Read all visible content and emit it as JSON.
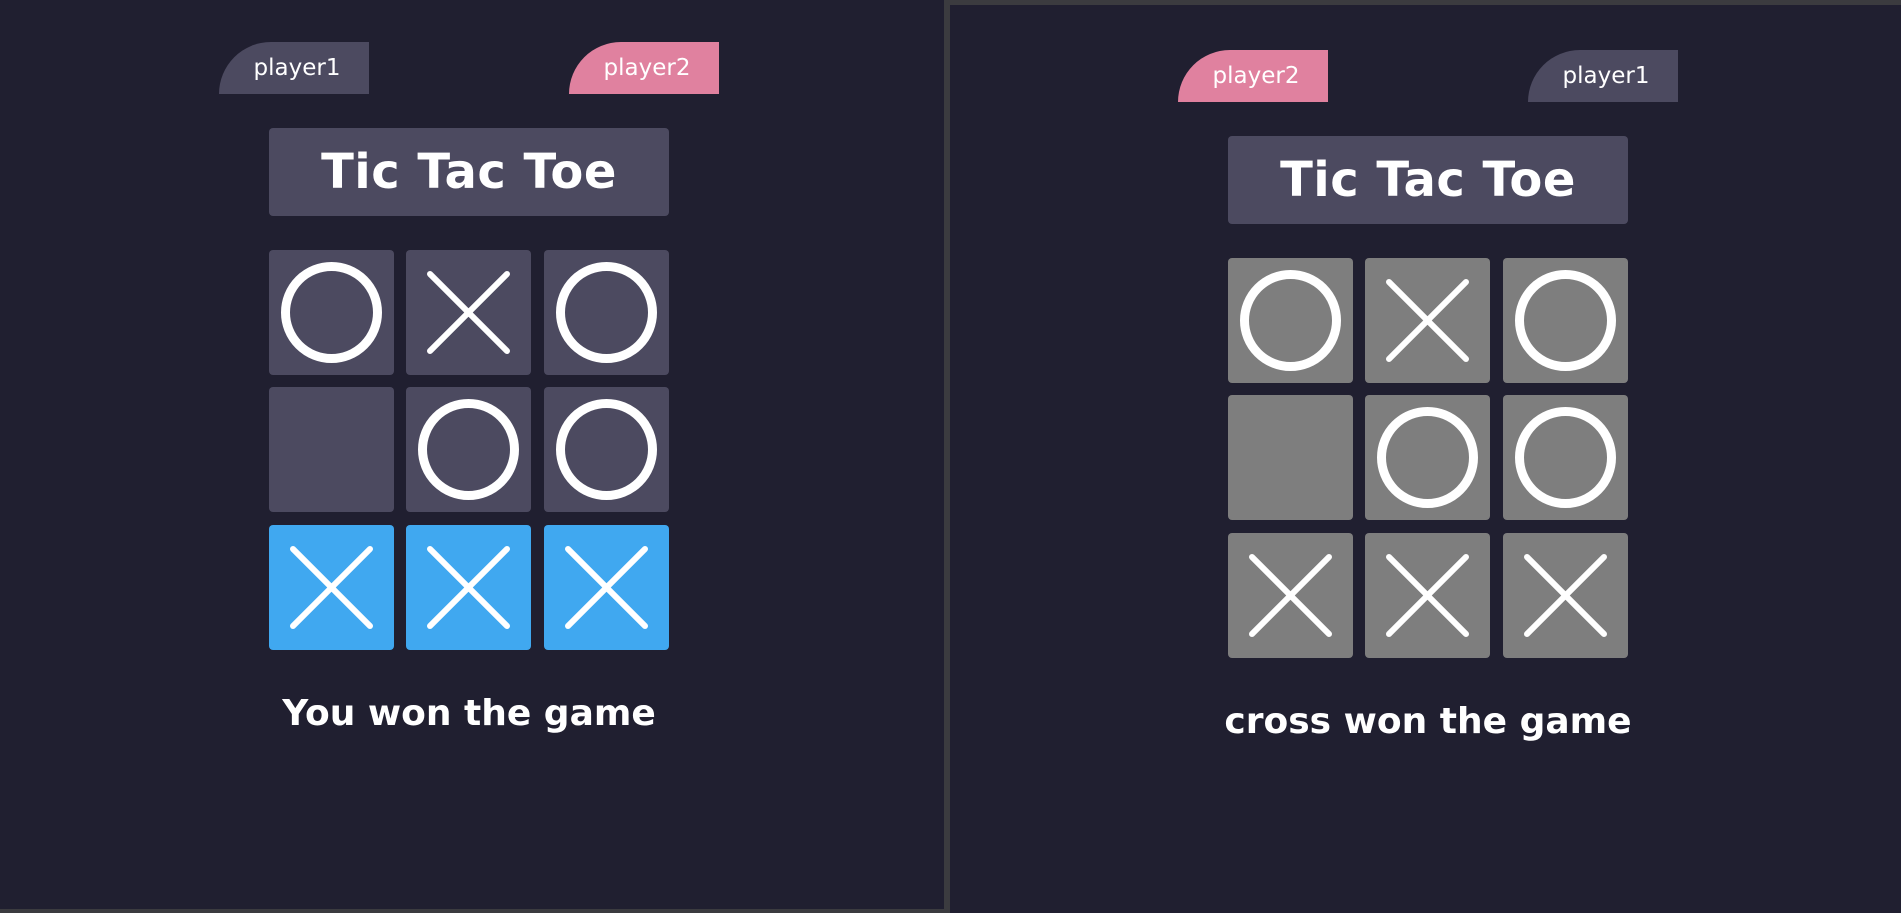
{
  "left_view": {
    "players": {
      "left_label": "player1",
      "right_label": "player2"
    },
    "title": "Tic Tac Toe",
    "board": {
      "cells": [
        "O",
        "X",
        "O",
        "",
        "O",
        "O",
        "X",
        "X",
        "X"
      ],
      "winning_cells": [
        6,
        7,
        8
      ]
    },
    "result_text": "You won the game"
  },
  "right_view": {
    "players": {
      "left_label": "player2",
      "right_label": "player1"
    },
    "title": "Tic Tac Toe",
    "board": {
      "cells": [
        "O",
        "X",
        "O",
        "",
        "O",
        "O",
        "X",
        "X",
        "X"
      ],
      "winning_cells": []
    },
    "result_text": "cross won the game"
  },
  "colors": {
    "background": "#201f30",
    "tile": "#4c4a60",
    "tile_disabled": "#7e7e7e",
    "win_highlight": "#40a8f0",
    "active_player": "#e0819f",
    "mark": "#ffffff"
  },
  "icons": {
    "X": "cross-icon",
    "O": "circle-icon"
  }
}
